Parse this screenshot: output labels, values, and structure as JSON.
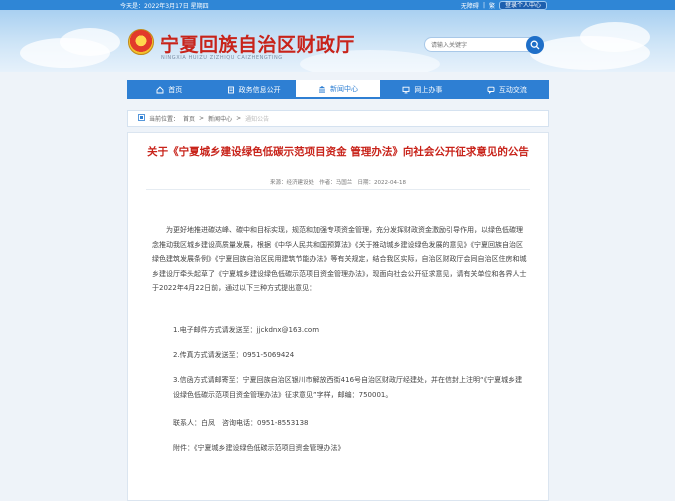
{
  "topbar": {
    "date": "今天是：2022年3月17日 星期四",
    "links": [
      "无障碍",
      "繁"
    ],
    "login": "登录个人中心"
  },
  "header": {
    "title": "宁夏回族自治区财政厅",
    "subtitle": "NINGXIA HUIZU ZIZHIQU CAIZHENGTING",
    "search_placeholder": "请输入关键字"
  },
  "nav": {
    "items": [
      {
        "label": "首页",
        "icon": "home-icon"
      },
      {
        "label": "政务信息公开",
        "icon": "document-icon"
      },
      {
        "label": "新闻中心",
        "icon": "building-icon"
      },
      {
        "label": "网上办事",
        "icon": "monitor-icon"
      },
      {
        "label": "互动交流",
        "icon": "chat-icon"
      }
    ],
    "active_index": 2
  },
  "breadcrumb": {
    "prefix": "当前位置：",
    "home": "首页",
    "sep": ">",
    "section": "新闻中心",
    "current": "通知公告"
  },
  "article": {
    "title": "关于《宁夏城乡建设绿色低碳示范项目资金 管理办法》向社会公开征求意见的公告",
    "meta": {
      "source_label": "来源：",
      "source": "经济建设处",
      "author_label": "作者：",
      "author": "马国兰",
      "date_label": "日期：",
      "date": "2022-04-18"
    },
    "p1": "为更好地推进碳达峰、碳中和目标实现，规范和加强专项资金管理，充分发挥财政资金激励引导作用，以绿色低碳理念推动我区城乡建设高质量发展，根据《中华人民共和国预算法》《关于推动城乡建设绿色发展的意见》《宁夏回族自治区绿色建筑发展条例》《宁夏回族自治区民用建筑节能办法》等有关规定，结合我区实际，自治区财政厅会同自治区住房和城乡建设厅牵头起草了《宁夏城乡建设绿色低碳示范项目资金管理办法》，现面向社会公开征求意见，请有关单位和各界人士于2022年4月22日前，通过以下三种方式提出意见：",
    "p2": "1.电子邮件方式请发送至：jjckdnx@163.com",
    "p3": "2.传真方式请发送至：0951-5069424",
    "p4": "3.信函方式请邮寄至：宁夏回族自治区银川市解放西街416号自治区财政厅经建处，并在信封上注明“《宁夏城乡建设绿色低碳示范项目资金管理办法》征求意见”字样，邮编：750001。",
    "contact": "联系人：白凤　咨询电话：0951-8553138",
    "attachment": "附件：《宁夏城乡建设绿色低碳示范项目资金管理办法》"
  }
}
